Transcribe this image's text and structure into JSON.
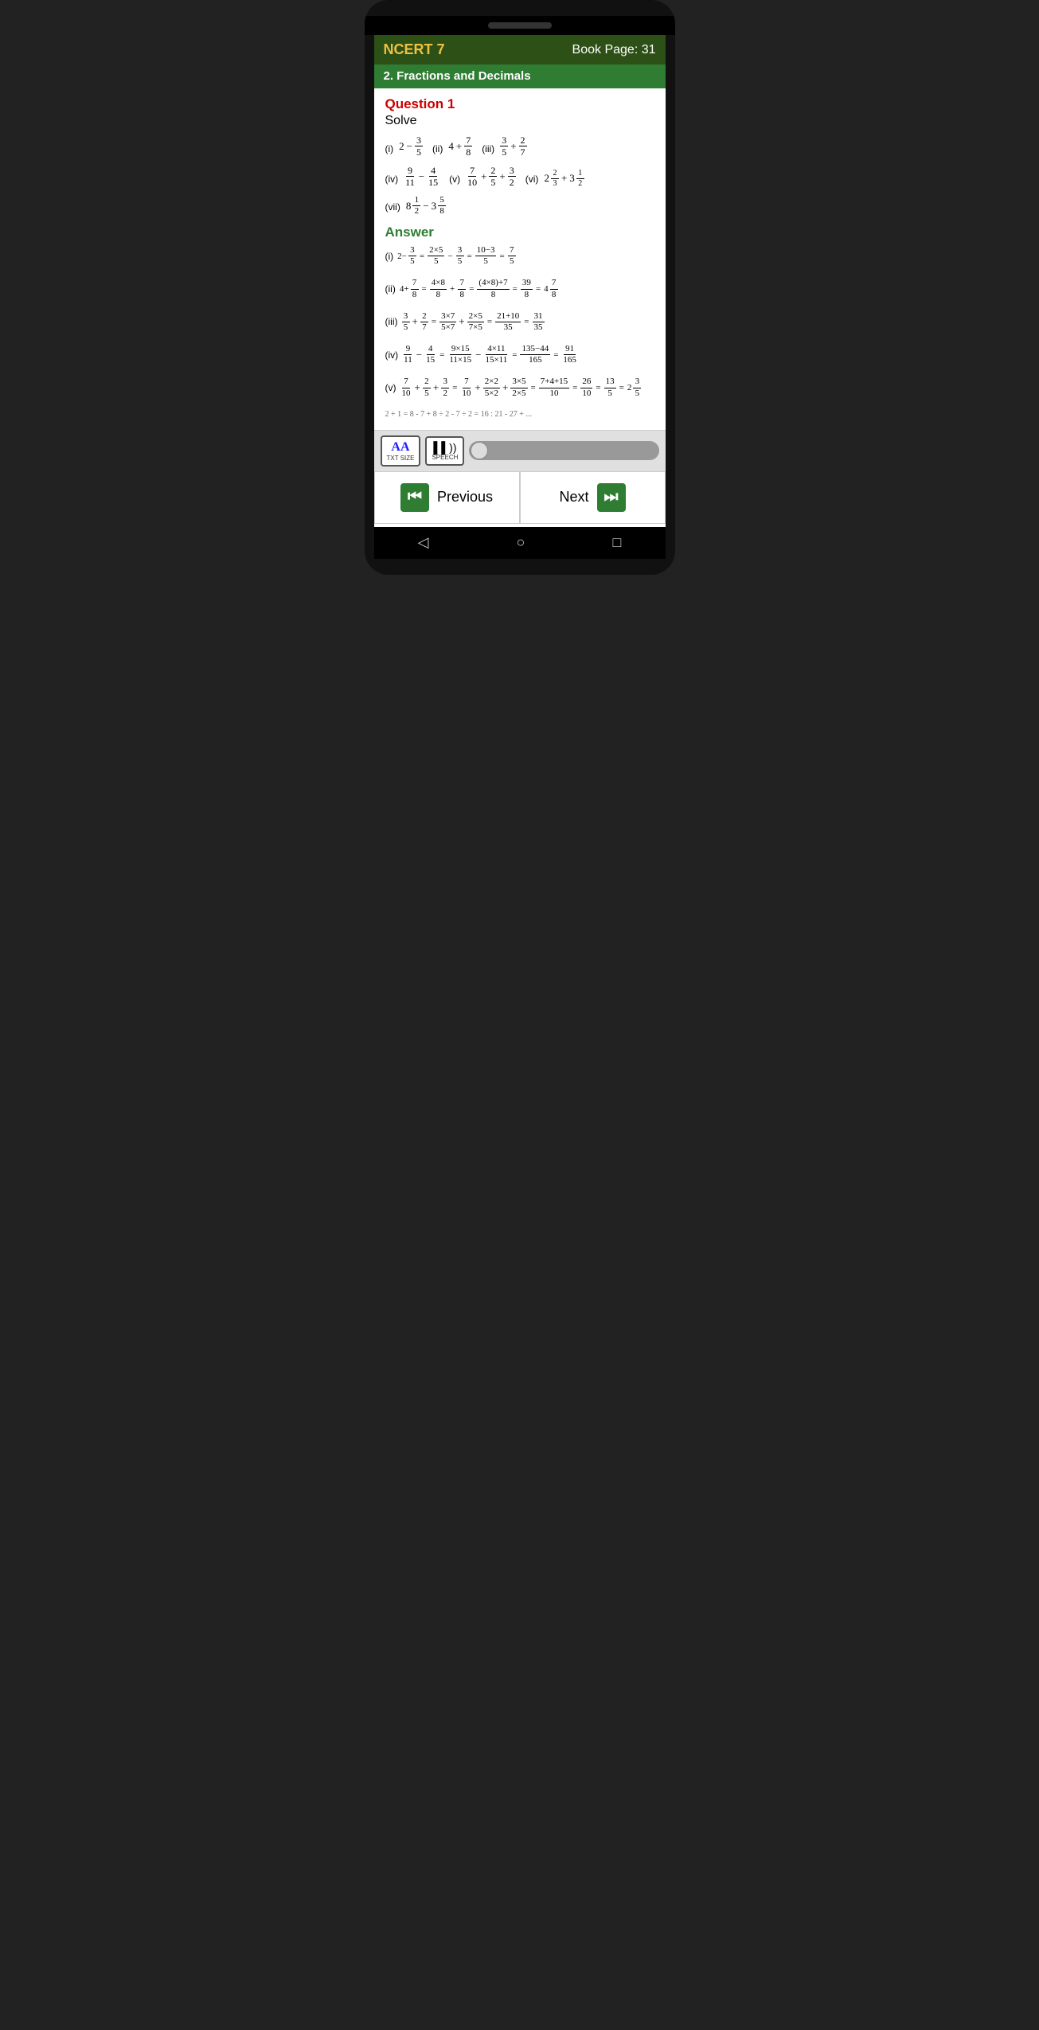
{
  "header": {
    "ncert": "NCERT 7",
    "book_page": "Book Page: 31",
    "chapter": "2. Fractions and Decimals"
  },
  "question": {
    "label": "Question 1",
    "instruction": "Solve"
  },
  "answer_label": "Answer",
  "nav": {
    "previous": "Previous",
    "next": "Next"
  },
  "toolbar": {
    "txt_size": "AA",
    "txt_label": "TXT SIZE",
    "speech_label": "SPEECH"
  }
}
